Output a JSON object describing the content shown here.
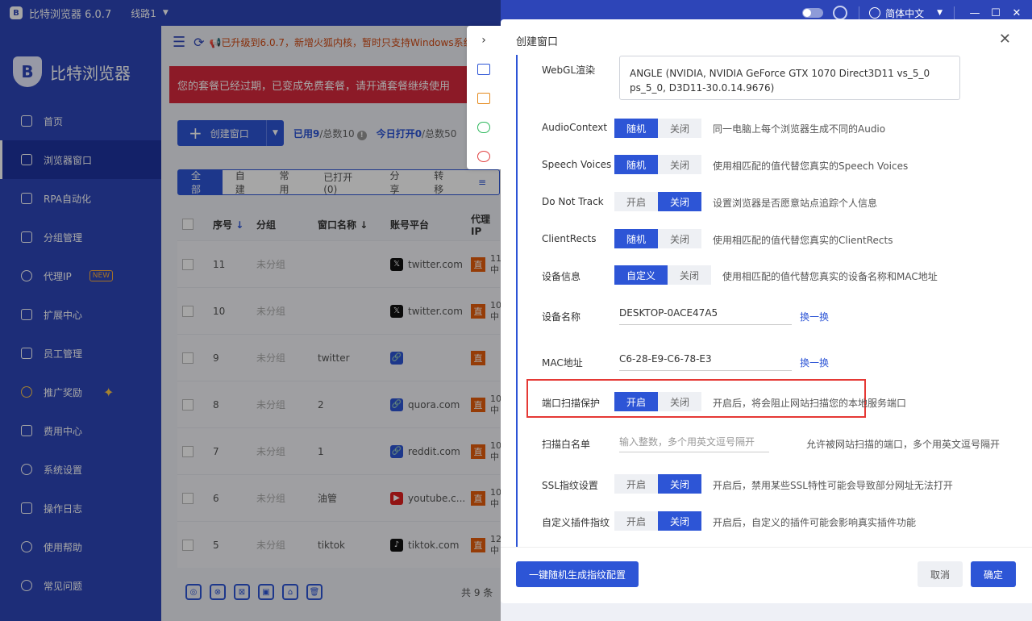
{
  "titlebar": {
    "logo": "B",
    "title": "比特浏览器 6.0.7",
    "line": "线路1",
    "language": "简体中文",
    "icons": [
      "theme-toggle-icon",
      "support-icon",
      "globe-icon",
      "chevron-down-icon",
      "minimize-icon",
      "maximize-icon",
      "close-icon"
    ]
  },
  "sidebar": {
    "brand": "比特浏览器",
    "items": [
      {
        "label": "首页",
        "icon": "home-icon"
      },
      {
        "label": "浏览器窗口",
        "icon": "grid-icon",
        "active": true
      },
      {
        "label": "RPA自动化",
        "icon": "robot-icon"
      },
      {
        "label": "分组管理",
        "icon": "folder-icon"
      },
      {
        "label": "代理IP",
        "icon": "location-icon",
        "badge": "NEW"
      },
      {
        "label": "扩展中心",
        "icon": "cube-icon"
      },
      {
        "label": "员工管理",
        "icon": "users-icon"
      },
      {
        "label": "推广奖励",
        "icon": "reward-icon"
      },
      {
        "label": "费用中心",
        "icon": "shield-icon"
      },
      {
        "label": "系统设置",
        "icon": "gear-icon"
      },
      {
        "label": "操作日志",
        "icon": "log-icon"
      },
      {
        "label": "使用帮助",
        "icon": "help-icon"
      },
      {
        "label": "常见问题",
        "icon": "info-icon"
      }
    ]
  },
  "notice": {
    "text": "📢已升级到6.0.7，新增火狐内核，暂时只支持Windows系统"
  },
  "expired": {
    "text": "您的套餐已经过期，已变成免费套餐，请开通套餐继续使用"
  },
  "toolbar": {
    "create_label": "创建窗口",
    "used": "已用9",
    "used_total": "/总数10",
    "opened_today": "今日打开0",
    "opened_total": "/总数50"
  },
  "tabs": [
    "全部",
    "自建",
    "常用",
    "已打开(0)",
    "分享",
    "转移"
  ],
  "table": {
    "headers": {
      "num": "序号",
      "group": "分组",
      "name": "窗口名称",
      "platform": "账号平台",
      "proxy": "代理IP"
    },
    "rows": [
      {
        "num": "11",
        "group": "未分组",
        "name": "",
        "platform": "twitter.com",
        "icon": "x",
        "proxy_a": "11",
        "proxy_b": "中"
      },
      {
        "num": "10",
        "group": "未分组",
        "name": "",
        "platform": "twitter.com",
        "icon": "x",
        "proxy_a": "10",
        "proxy_b": "中"
      },
      {
        "num": "9",
        "group": "未分组",
        "name": "twitter",
        "platform": "",
        "icon": "link",
        "proxy_a": "",
        "proxy_b": ""
      },
      {
        "num": "8",
        "group": "未分组",
        "name": "2",
        "platform": "quora.com",
        "icon": "link",
        "proxy_a": "10",
        "proxy_b": "中"
      },
      {
        "num": "7",
        "group": "未分组",
        "name": "1",
        "platform": "reddit.com",
        "icon": "link",
        "proxy_a": "10",
        "proxy_b": "中"
      },
      {
        "num": "6",
        "group": "未分组",
        "name": "油管",
        "platform": "youtube.c...",
        "icon": "yt",
        "proxy_a": "10",
        "proxy_b": "中"
      },
      {
        "num": "5",
        "group": "未分组",
        "name": "tiktok",
        "platform": "tiktok.com",
        "icon": "tt",
        "proxy_a": "12",
        "proxy_b": "中"
      }
    ],
    "direct": "直",
    "total": "共 9 条"
  },
  "modal": {
    "title": "创建窗口",
    "webgl": {
      "label": "WebGL渲染",
      "value": "ANGLE (NVIDIA, NVIDIA GeForce GTX 1070 Direct3D11 vs_5_0 ps_5_0, D3D11-30.0.14.9676)"
    },
    "audio": {
      "label": "AudioContext",
      "opt1": "随机",
      "opt2": "关闭",
      "desc": "同一电脑上每个浏览器生成不同的Audio"
    },
    "speech": {
      "label": "Speech Voices",
      "opt1": "随机",
      "opt2": "关闭",
      "desc": "使用相匹配的值代替您真实的Speech Voices"
    },
    "dnt": {
      "label": "Do Not Track",
      "opt1": "开启",
      "opt2": "关闭",
      "desc": "设置浏览器是否愿意站点追踪个人信息"
    },
    "rects": {
      "label": "ClientRects",
      "opt1": "随机",
      "opt2": "关闭",
      "desc": "使用相匹配的值代替您真实的ClientRects"
    },
    "device_info": {
      "label": "设备信息",
      "opt1": "自定义",
      "opt2": "关闭",
      "desc": "使用相匹配的值代替您真实的设备名称和MAC地址"
    },
    "device_name": {
      "label": "设备名称",
      "value": "DESKTOP-0ACE47A5",
      "link": "换一换"
    },
    "mac": {
      "label": "MAC地址",
      "value": "C6-28-E9-C6-78-E3",
      "link": "换一换"
    },
    "port_protect": {
      "label": "端口扫描保护",
      "opt1": "开启",
      "opt2": "关闭",
      "desc": "开启后，将会阻止网站扫描您的本地服务端口"
    },
    "whitelist": {
      "label": "扫描白名单",
      "placeholder": "输入整数，多个用英文逗号隔开",
      "desc": "允许被网站扫描的端口，多个用英文逗号隔开"
    },
    "ssl": {
      "label": "SSL指纹设置",
      "opt1": "开启",
      "opt2": "关闭",
      "desc": "开启后，禁用某些SSL特性可能会导致部分网址无法打开"
    },
    "plugin": {
      "label": "自定义插件指纹",
      "opt1": "开启",
      "opt2": "关闭",
      "desc": "开启后，自定义的插件可能会影响真实插件功能"
    },
    "gen_button": "一键随机生成指纹配置",
    "cancel": "取消",
    "ok": "确定"
  }
}
